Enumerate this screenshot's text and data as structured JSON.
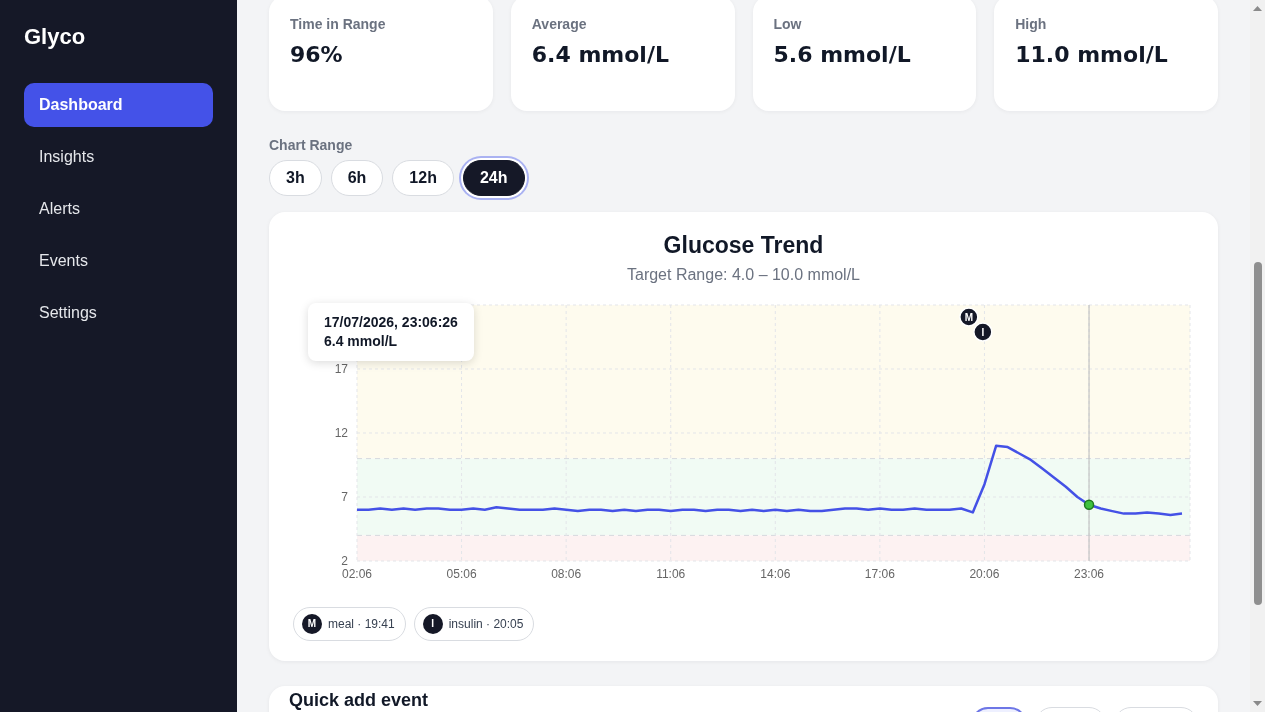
{
  "sidebar": {
    "logo": "Glyco",
    "items": [
      {
        "label": "Dashboard",
        "selected": true
      },
      {
        "label": "Insights",
        "selected": false
      },
      {
        "label": "Alerts",
        "selected": false
      },
      {
        "label": "Events",
        "selected": false
      },
      {
        "label": "Settings",
        "selected": false
      }
    ]
  },
  "stats": [
    {
      "label": "Time in Range",
      "value": "96%"
    },
    {
      "label": "Average",
      "value": "6.4 mmol/L"
    },
    {
      "label": "Low",
      "value": "5.6 mmol/L"
    },
    {
      "label": "High",
      "value": "11.0 mmol/L"
    }
  ],
  "chart_range": {
    "label": "Chart Range",
    "options": [
      {
        "label": "3h",
        "selected": false
      },
      {
        "label": "6h",
        "selected": false
      },
      {
        "label": "12h",
        "selected": false
      },
      {
        "label": "24h",
        "selected": true
      }
    ]
  },
  "chart": {
    "title": "Glucose Trend",
    "subtitle": "Target Range: 4.0 – 10.0 mmol/L",
    "chart_data": {
      "type": "line",
      "categories": [
        "02:06",
        null,
        null,
        null,
        null,
        null,
        null,
        null,
        null,
        "05:06",
        null,
        null,
        null,
        null,
        null,
        null,
        null,
        null,
        "08:06",
        null,
        null,
        null,
        null,
        null,
        null,
        null,
        null,
        "11:06",
        null,
        null,
        null,
        null,
        null,
        null,
        null,
        null,
        "14:06",
        null,
        null,
        null,
        null,
        null,
        null,
        null,
        null,
        "17:06",
        null,
        null,
        null,
        null,
        null,
        null,
        null,
        null,
        "20:06",
        null,
        null,
        null,
        null,
        null,
        null,
        null,
        null,
        "23:06",
        null,
        null,
        null,
        null,
        null,
        null,
        null,
        null
      ],
      "series": [
        {
          "color": "#4451e6",
          "values": [
            6.0,
            6.0,
            6.1,
            6.0,
            6.1,
            6.0,
            6.1,
            6.1,
            6.0,
            6.0,
            6.1,
            6.0,
            6.2,
            6.1,
            6.0,
            6.0,
            6.0,
            6.1,
            6.0,
            5.9,
            6.0,
            6.0,
            5.9,
            6.0,
            5.9,
            6.0,
            6.0,
            5.9,
            6.0,
            6.0,
            5.9,
            6.0,
            6.0,
            5.9,
            6.0,
            5.9,
            6.0,
            5.9,
            6.0,
            5.9,
            5.9,
            6.0,
            6.1,
            6.1,
            6.0,
            6.1,
            6.0,
            6.0,
            6.1,
            6.0,
            6.0,
            6.0,
            6.1,
            5.8,
            8.0,
            11.0,
            10.9,
            10.4,
            9.9,
            9.2,
            8.5,
            7.8,
            7.0,
            6.4,
            6.1,
            5.9,
            5.7,
            5.7,
            5.8,
            5.7,
            5.6,
            5.7
          ]
        }
      ],
      "ylim": [
        2,
        22
      ],
      "yticks": [
        2,
        7,
        12,
        17
      ],
      "grid": true,
      "ref_lines": [
        {
          "axis": "x",
          "value": "23:06"
        }
      ],
      "annotations": [
        {
          "text": "M"
        },
        {
          "text": "I"
        }
      ]
    },
    "tooltip": {
      "title": "17/07/2026, 23:06:26",
      "value": "6.4 mmol/L"
    },
    "events": [
      {
        "badge": "M",
        "label": "meal · 19:41"
      },
      {
        "badge": "I",
        "label": "insulin · 20:05"
      }
    ]
  },
  "quick_add": {
    "title": "Quick add event",
    "options": [
      {
        "selected": true
      },
      {
        "selected": false
      },
      {
        "selected": false
      }
    ]
  }
}
